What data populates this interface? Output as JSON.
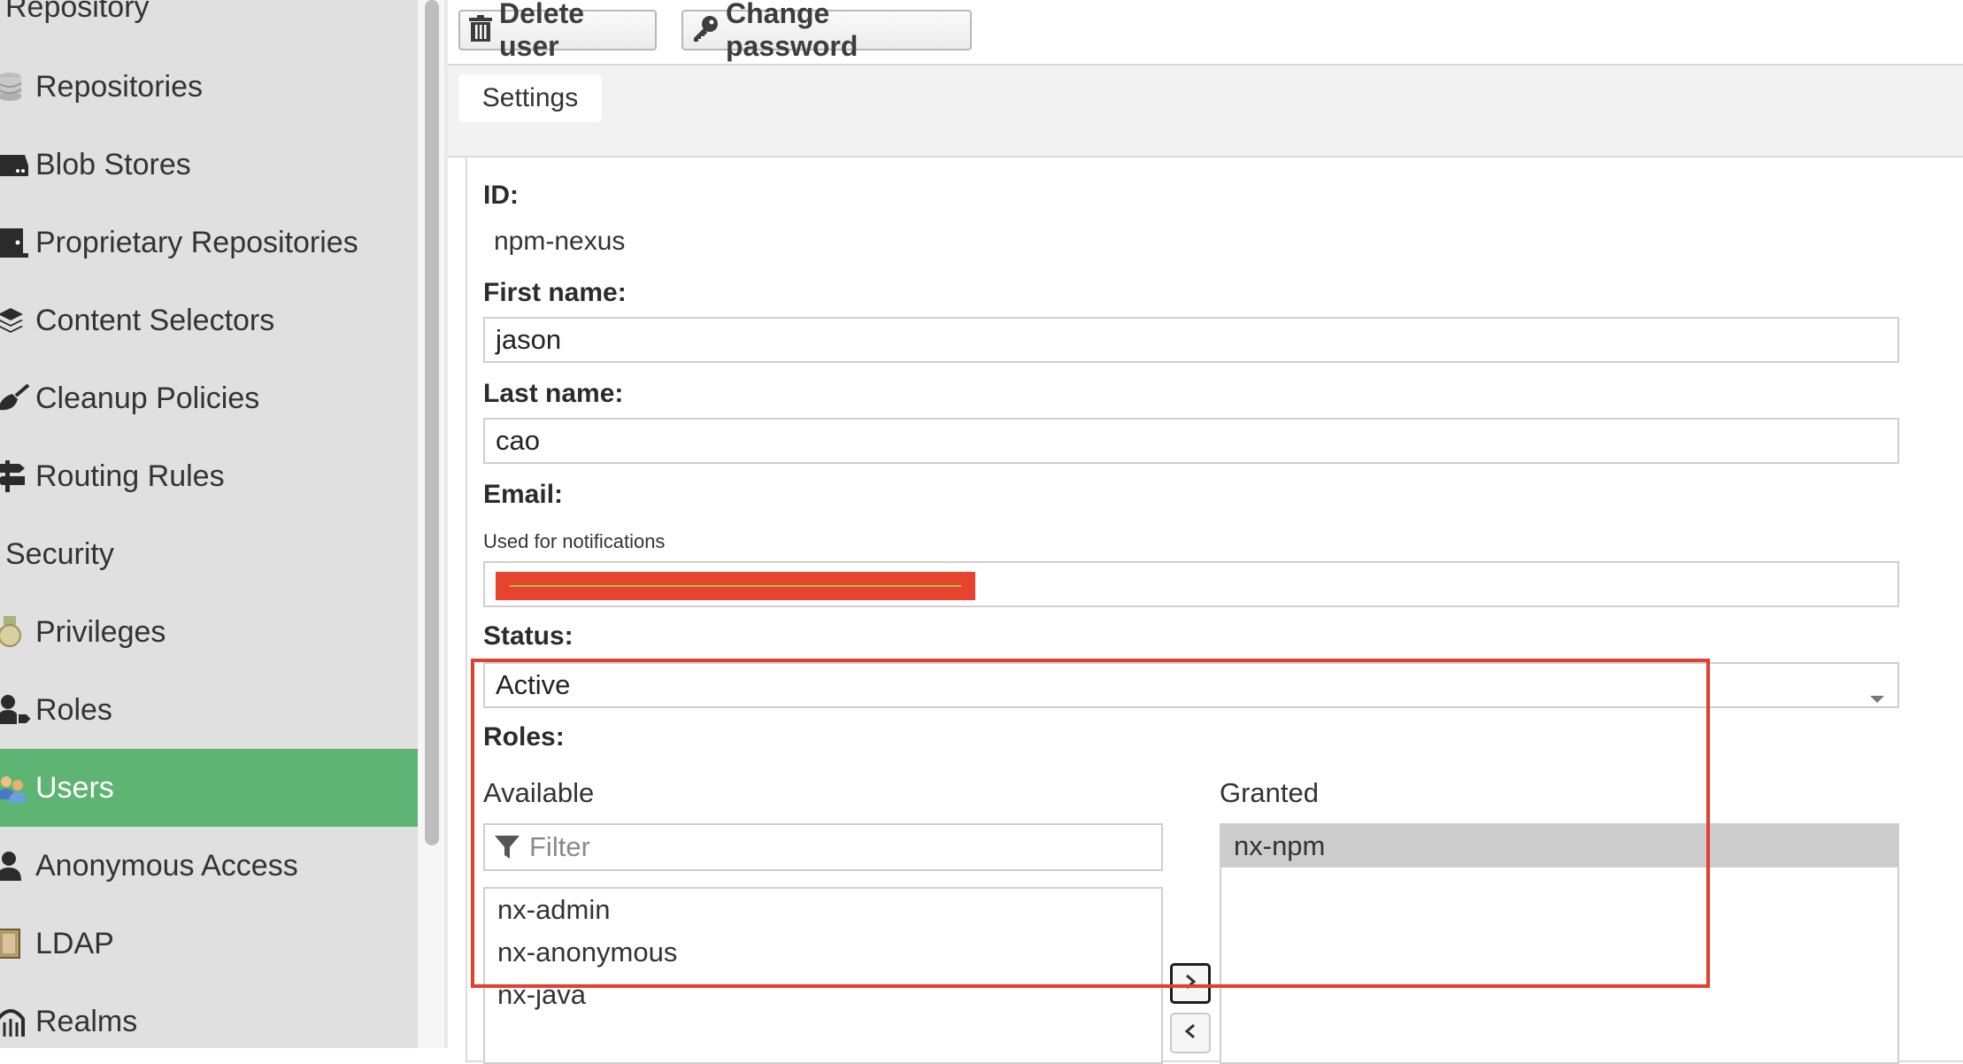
{
  "sidebar": {
    "headings": {
      "repository": "Repository",
      "security": "Security"
    },
    "items": [
      {
        "label": "Repositories",
        "icon": "database-icon"
      },
      {
        "label": "Blob Stores",
        "icon": "hard-drive-icon"
      },
      {
        "label": "Proprietary Repositories",
        "icon": "door-icon"
      },
      {
        "label": "Content Selectors",
        "icon": "layers-icon"
      },
      {
        "label": "Cleanup Policies",
        "icon": "broom-icon"
      },
      {
        "label": "Routing Rules",
        "icon": "signpost-icon"
      },
      {
        "label": "Privileges",
        "icon": "medal-icon"
      },
      {
        "label": "Roles",
        "icon": "user-tag-icon"
      },
      {
        "label": "Users",
        "icon": "users-icon"
      },
      {
        "label": "Anonymous Access",
        "icon": "user-icon"
      },
      {
        "label": "LDAP",
        "icon": "book-icon"
      },
      {
        "label": "Realms",
        "icon": "realm-icon"
      }
    ],
    "active_item": "Users",
    "active_color": "#5eb472"
  },
  "toolbar": {
    "delete_label": "Delete user",
    "change_password_label": "Change password"
  },
  "tabs": {
    "settings": "Settings"
  },
  "form": {
    "id_label": "ID:",
    "id_value": "npm-nexus",
    "first_name_label": "First name:",
    "first_name_value": "jason",
    "last_name_label": "Last name:",
    "last_name_value": "cao",
    "email_label": "Email:",
    "email_help": "Used for notifications",
    "email_redacted_color": "#e8432e",
    "status_label": "Status:",
    "status_value": "Active",
    "roles_label": "Roles:",
    "available_label": "Available",
    "filter_placeholder": "Filter",
    "available_roles": [
      "nx-admin",
      "nx-anonymous",
      "nx-java"
    ],
    "granted_label": "Granted",
    "granted_roles": [
      "nx-npm"
    ]
  },
  "annotation_color": "#e2402f"
}
